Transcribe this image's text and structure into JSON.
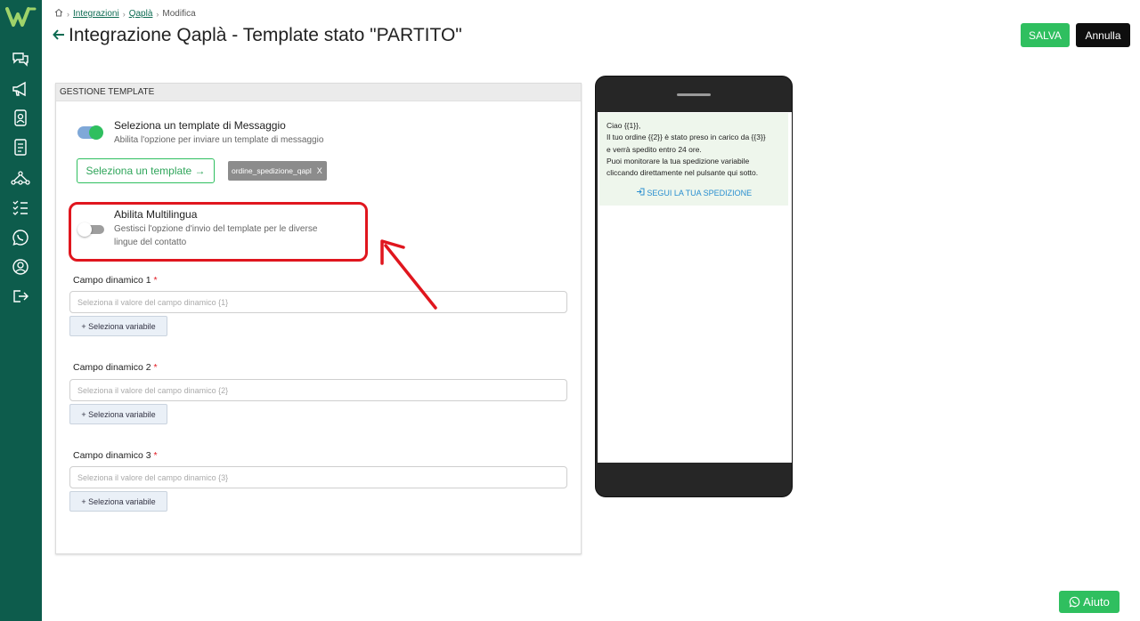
{
  "breadcrumb": {
    "home_icon": "home-icon",
    "integrations": "Integrazioni",
    "qapla": "Qaplà",
    "current": "Modifica"
  },
  "header": {
    "title": "Integrazione Qaplà - Template stato \"PARTITO\"",
    "save_label": "SALVA",
    "cancel_label": "Annulla"
  },
  "sidebar": {
    "items": [
      "chat-icon",
      "megaphone-icon",
      "contacts-icon",
      "document-icon",
      "flow-icon",
      "checklist-icon",
      "whatsapp-icon",
      "user-icon",
      "logout-icon"
    ]
  },
  "card": {
    "header": "GESTIONE TEMPLATE",
    "template_option": {
      "title": "Seleziona un template di Messaggio",
      "description": "Abilita l'opzione per inviare un template di messaggio",
      "enabled": true
    },
    "select_template_button": "Seleziona un template →",
    "template_chip": {
      "label": "ordine_spedizione_qapl",
      "remove": "X"
    },
    "multilang_option": {
      "title": "Abilita Multilingua",
      "description_line1": "Gestisci l'opzione d'invio del template per le diverse",
      "description_line2": "lingue del contatto",
      "enabled": false
    },
    "fields": [
      {
        "label": "Campo dinamico 1",
        "required": "*",
        "placeholder": "Seleziona il valore del campo dinamico {1}",
        "button": "+ Seleziona variabile"
      },
      {
        "label": "Campo dinamico 2",
        "required": "*",
        "placeholder": "Seleziona il valore del campo dinamico {2}",
        "button": "+ Seleziona variabile"
      },
      {
        "label": "Campo dinamico 3",
        "required": "*",
        "placeholder": "Seleziona il valore del campo dinamico {3}",
        "button": "+ Seleziona variabile"
      }
    ]
  },
  "preview": {
    "lines": [
      "Ciao {{1}},",
      "Il tuo ordine {{2}} è stato preso in carico da {{3}}",
      "e verrà spedito entro 24 ore.",
      "Puoi monitorare la tua spedizione variabile",
      "cliccando direttamente nel pulsante qui sotto."
    ],
    "cta": "SEGUI LA TUA SPEDIZIONE"
  },
  "help": {
    "label": "Aiuto"
  },
  "colors": {
    "sidebar": "#0d5c4c",
    "accent": "#2fbf5f",
    "highlight": "#e0161e"
  }
}
